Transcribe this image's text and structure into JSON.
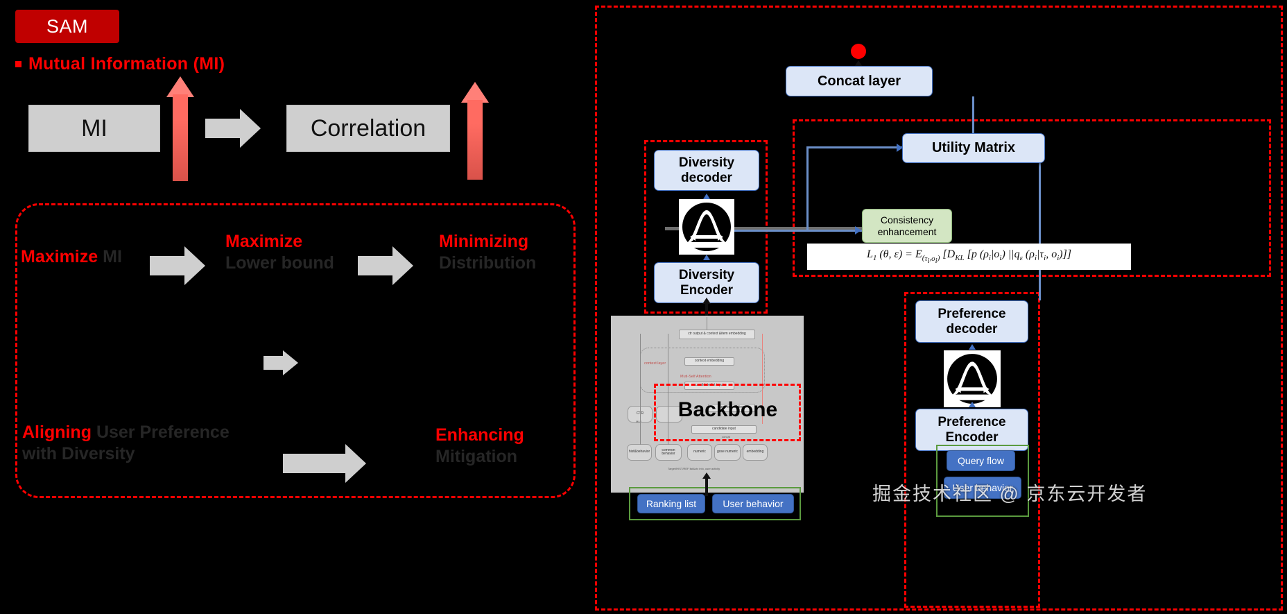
{
  "left": {
    "badge": "SAM",
    "bullet": "Mutual Information (MI)",
    "mi_box": "MI",
    "correlation_box": "Correlation",
    "flow": {
      "maximize_mi_red": "Maximize",
      "maximize_mi_dim": "MI",
      "maximize_lb_red": "Maximize",
      "maximize_lb_dim": "Lower bound",
      "minimizing_red": "Minimizing",
      "minimizing_dim": "Distribution",
      "aligning_red": "Aligning",
      "aligning_dim": "User Preference",
      "aligning_dim2": "with Diversity",
      "enhancing_red": "Enhancing",
      "enhancing_dim": "Mitigation"
    }
  },
  "right": {
    "concat_layer": "Concat layer",
    "utility_matrix": "Utility Matrix",
    "consistency_enhancement": "Consistency\nenhancement",
    "diversity_decoder": "Diversity\ndecoder",
    "diversity_encoder": "Diversity\nEncoder",
    "preference_decoder": "Preference\ndecoder",
    "preference_encoder": "Preference\nEncoder",
    "backbone_label": "Backbone",
    "ranking_list": "Ranking list",
    "user_behavior_left": "User behavior",
    "query_flow": "Query flow",
    "user_behavior_right": "User behavior",
    "formula": "L₁ (θ, ε) = E(τi,oi) [DKL [p (ρi|oi) ||qε (ρi|τi, oi)]]",
    "formula_parts": {
      "lhs": "L",
      "lhs_sub": "1",
      "args": " (θ, ε) = E",
      "exp_sub": "(τi,oi)",
      "rhs": " [D",
      "kl_sub": "KL",
      "tail": " [p (ρi|oi) ||q",
      "q_sub": "ε",
      "tail2": " (ρi|τi, oi)]]"
    },
    "backbone": {
      "top_node": "ctr output & context &item embedding",
      "context_layer_label": "context layer",
      "context_embedding": "context embedding",
      "self_attention_label": "Muti-Self Attention",
      "candidate_list_input": "candidate list input",
      "item_embedding": "item embedding",
      "candidate_input": "candidate input",
      "ctr_node": "CTR",
      "mlp_label": "MLP",
      "nodes_row": [
        "hist&behavior",
        "common behavior",
        "numeric",
        "gose numeric",
        "embedding"
      ],
      "concat_label": "concat",
      "caption": "Target/HIST/REF list&ctx info, user activity"
    }
  },
  "watermark": "掘金技术社区 @ 京东云开发者",
  "colors": {
    "red": "#FF0000",
    "badge_red": "#C00000",
    "box_blue": "#DCE6F7",
    "blue_fill": "#4472C4",
    "green_fill": "#D3E6C3",
    "gray_arrow": "#CFCFCF"
  }
}
